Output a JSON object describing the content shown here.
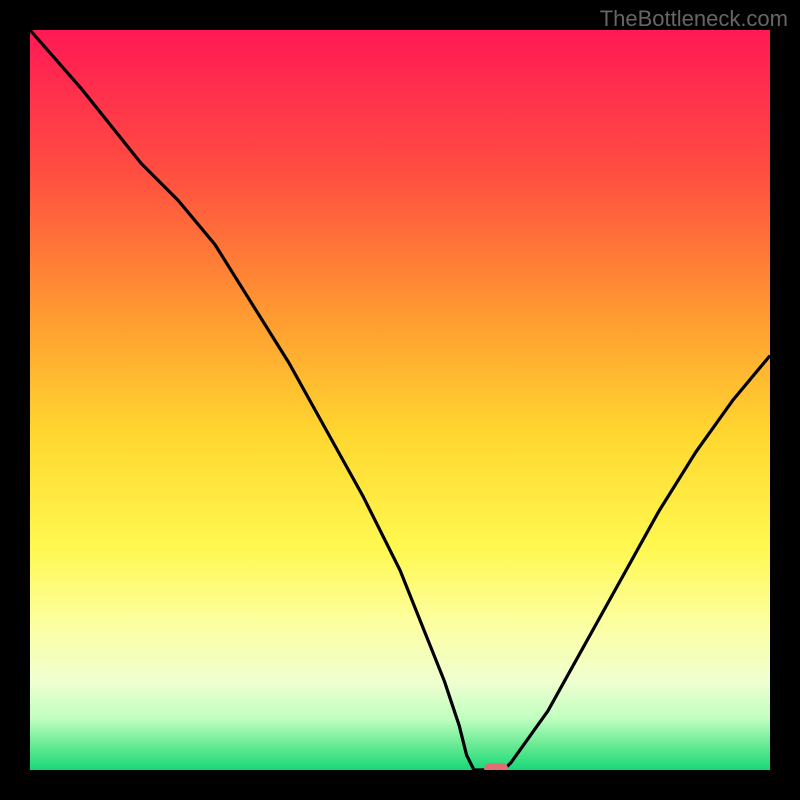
{
  "watermark": "TheBottleneck.com",
  "chart_data": {
    "type": "line",
    "title": "",
    "xlabel": "",
    "ylabel": "",
    "xlim": [
      0,
      100
    ],
    "ylim": [
      0,
      100
    ],
    "series": [
      {
        "name": "bottleneck-curve",
        "x": [
          0,
          7,
          15,
          20,
          25,
          30,
          35,
          40,
          45,
          50,
          54,
          56,
          58,
          59,
          60,
          62,
          64,
          65,
          70,
          75,
          80,
          85,
          90,
          95,
          100
        ],
        "y": [
          100,
          92,
          82,
          77,
          71,
          63,
          55,
          46,
          37,
          27,
          17,
          12,
          6,
          2,
          0,
          0,
          0,
          1,
          8,
          17,
          26,
          35,
          43,
          50,
          56
        ]
      }
    ],
    "marker": {
      "x": 63,
      "y": 0,
      "color": "#e07070"
    },
    "gradient_stops": [
      {
        "offset": 0,
        "color": "#ff1955"
      },
      {
        "offset": 20,
        "color": "#ff5040"
      },
      {
        "offset": 40,
        "color": "#ffa030"
      },
      {
        "offset": 55,
        "color": "#ffd830"
      },
      {
        "offset": 70,
        "color": "#fff850"
      },
      {
        "offset": 80,
        "color": "#fcffa0"
      },
      {
        "offset": 88,
        "color": "#f0ffd0"
      },
      {
        "offset": 93,
        "color": "#c0ffc0"
      },
      {
        "offset": 97,
        "color": "#60e890"
      },
      {
        "offset": 100,
        "color": "#18d878"
      }
    ]
  }
}
